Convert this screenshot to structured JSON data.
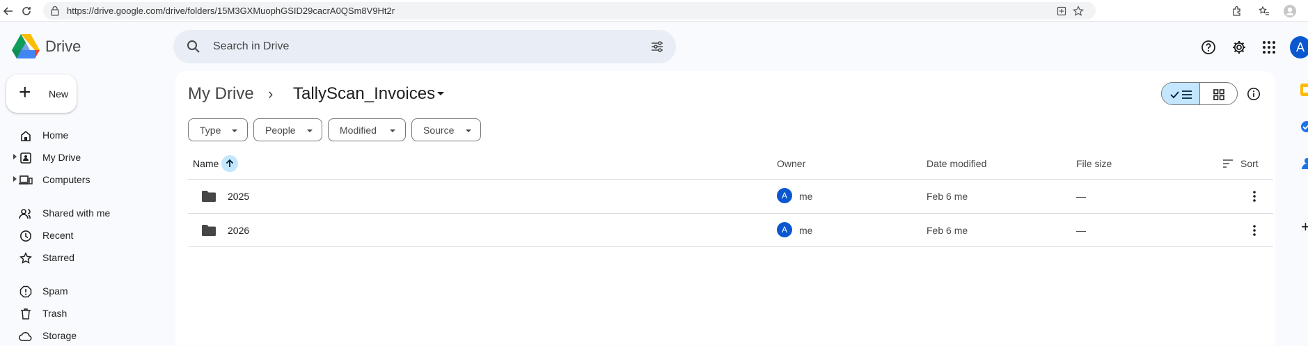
{
  "browser": {
    "url": "https://drive.google.com/drive/folders/15M3GXMuophGSID29cacrA0QSm8V9Ht2r"
  },
  "header": {
    "app_title": "Drive",
    "search_placeholder": "Search in Drive",
    "account_initial": "A"
  },
  "sidebar": {
    "new_label": "New",
    "items": [
      {
        "label": "Home",
        "icon": "home-icon"
      },
      {
        "label": "My Drive",
        "icon": "my-drive-icon"
      },
      {
        "label": "Computers",
        "icon": "computers-icon"
      },
      {
        "label": "Shared with me",
        "icon": "shared-icon"
      },
      {
        "label": "Recent",
        "icon": "clock-icon"
      },
      {
        "label": "Starred",
        "icon": "star-icon"
      },
      {
        "label": "Spam",
        "icon": "spam-icon"
      },
      {
        "label": "Trash",
        "icon": "trash-icon"
      },
      {
        "label": "Storage",
        "icon": "cloud-icon"
      }
    ]
  },
  "breadcrumb": {
    "root": "My Drive",
    "separator": "›",
    "current": "TallyScan_Invoices"
  },
  "filters": [
    "Type",
    "People",
    "Modified",
    "Source"
  ],
  "table": {
    "columns": {
      "name": "Name",
      "owner": "Owner",
      "date": "Date modified",
      "size": "File size",
      "sort": "Sort"
    },
    "rows": [
      {
        "name": "2025",
        "owner_initial": "A",
        "owner": "me",
        "date": "Feb 6 me",
        "size": "—"
      },
      {
        "name": "2026",
        "owner_initial": "A",
        "owner": "me",
        "date": "Feb 6 me",
        "size": "—"
      }
    ]
  },
  "colors": {
    "accent": "#0b57d0",
    "selected_toggle": "#c2e7ff",
    "background": "#f8fafd",
    "search_bg": "#e9eef6"
  }
}
